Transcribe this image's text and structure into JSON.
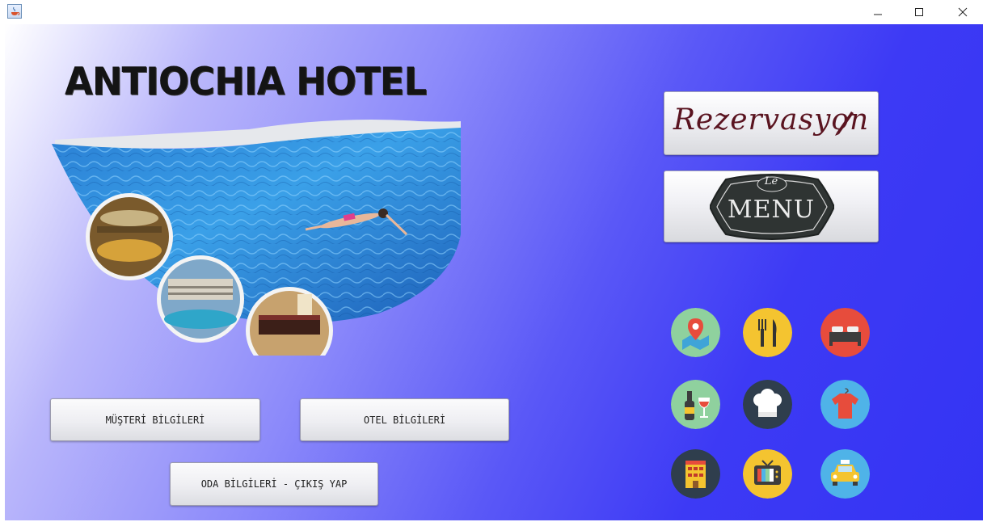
{
  "window": {
    "icon": "java-cup-icon",
    "controls": {
      "minimize": "minimize-icon",
      "maximize": "maximize-icon",
      "close": "close-icon"
    }
  },
  "hotel": {
    "title": "ANTIOCHIA HOTEL"
  },
  "buttons": {
    "rezervasyon": "Rezervasyon",
    "menu_le": "Le",
    "menu_label": "MENU",
    "musteri": "MÜŞTERİ BİLGİLERİ",
    "otel": "OTEL BİLGİLERİ",
    "oda": "ODA BİLGİLERİ - ÇIKIŞ YAP"
  },
  "icons": [
    "map-location-icon",
    "restaurant-cutlery-icon",
    "bed-icon",
    "wine-icon",
    "chef-hat-icon",
    "laundry-shirt-icon",
    "hotel-building-icon",
    "tv-icon",
    "taxi-icon"
  ],
  "colors": {
    "background_light": "#ffffff",
    "background_dark": "#3434f3",
    "title_text": "#141414",
    "rezervasyon_text": "#5a1420",
    "menu_board": "#2f3433"
  }
}
